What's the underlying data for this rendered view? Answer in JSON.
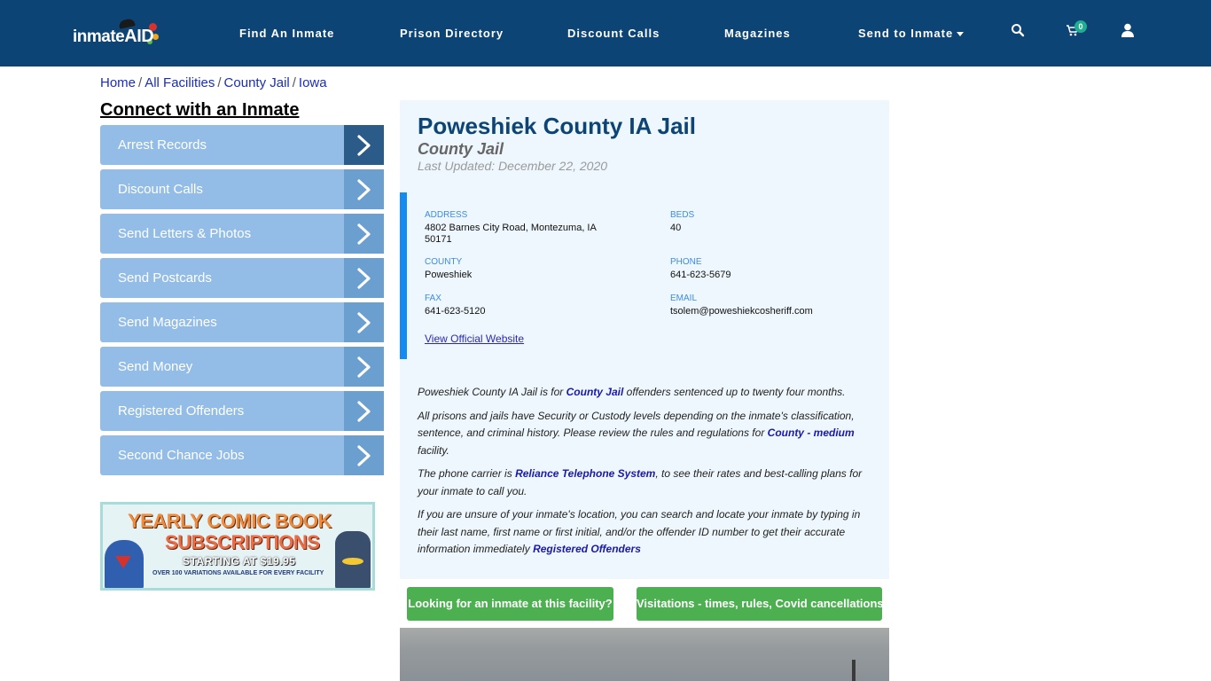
{
  "header": {
    "logo_text": "inmate",
    "logo_text_accent": "AID",
    "nav": [
      {
        "label": "Find An Inmate"
      },
      {
        "label": "Prison Directory"
      },
      {
        "label": "Discount Calls"
      },
      {
        "label": "Magazines"
      },
      {
        "label": "Send to Inmate",
        "has_dropdown": true
      }
    ],
    "icons": {
      "search": "search-icon",
      "cart": "cart-icon",
      "user": "user-icon"
    },
    "cart_count": "0",
    "colors": {
      "background": "#0c4475",
      "badge": "#1fae8f"
    }
  },
  "breadcrumb": [
    {
      "label": "Home"
    },
    {
      "label": "All Facilities"
    },
    {
      "label": "County Jail"
    },
    {
      "label": "Iowa"
    }
  ],
  "sidebar": {
    "title": "Connect with an Inmate",
    "items": [
      {
        "label": "Arrest Records",
        "active": true
      },
      {
        "label": "Discount Calls"
      },
      {
        "label": "Send Letters & Photos"
      },
      {
        "label": "Send Postcards"
      },
      {
        "label": "Send Magazines"
      },
      {
        "label": "Send Money"
      },
      {
        "label": "Registered Offenders"
      },
      {
        "label": "Second Chance Jobs"
      }
    ],
    "ad": {
      "line1": "YEARLY COMIC BOOK",
      "line2": "SUBSCRIPTIONS",
      "line3": "STARTING AT $19.95",
      "line4": "OVER 100 VARIATIONS AVAILABLE FOR EVERY FACILITY"
    }
  },
  "facility": {
    "name": "Poweshiek County IA Jail",
    "type": "County Jail",
    "last_updated": "Last Updated: December 22, 2020",
    "fields": {
      "address": {
        "label": "ADDRESS",
        "value_line1": "4802 Barnes City Road, Montezuma, IA",
        "value_line2": "50171"
      },
      "beds": {
        "label": "BEDS",
        "value": "40"
      },
      "county": {
        "label": "COUNTY",
        "value": "Poweshiek"
      },
      "phone": {
        "label": "PHONE",
        "value": "641-623-5679"
      },
      "fax": {
        "label": "FAX",
        "value": "641-623-5120"
      },
      "email": {
        "label": "EMAIL",
        "value": "tsolem@poweshiekcosheriff.com"
      }
    },
    "website_link": "View Official Website",
    "description": {
      "p1_a": "Poweshiek County IA Jail is for ",
      "p1_link": "County Jail",
      "p1_b": " offenders sentenced up to twenty four months.",
      "p2_a": "All prisons and jails have Security or Custody levels depending on the inmate's classification, sentence, and criminal history. Please review the rules and regulations for ",
      "p2_link": "County - medium",
      "p2_b": " facility.",
      "p3_a": "The phone carrier is ",
      "p3_link": "Reliance Telephone System",
      "p3_b": ", to see their rates and best-calling plans for your inmate to call you.",
      "p4_a": "If you are unsure of your inmate's location, you can search and locate your inmate by typing in their last name, first name or first initial, and/or the offender ID number to get their accurate information immediately ",
      "p4_link": "Registered Offenders"
    },
    "buttons": {
      "find_inmate": "Looking for an inmate at this facility?",
      "visitations": "Visitations - times, rules, Covid cancellations"
    },
    "colors": {
      "title": "#0c4475",
      "accent_bar": "#138bf0",
      "button": "#4caf50"
    }
  }
}
